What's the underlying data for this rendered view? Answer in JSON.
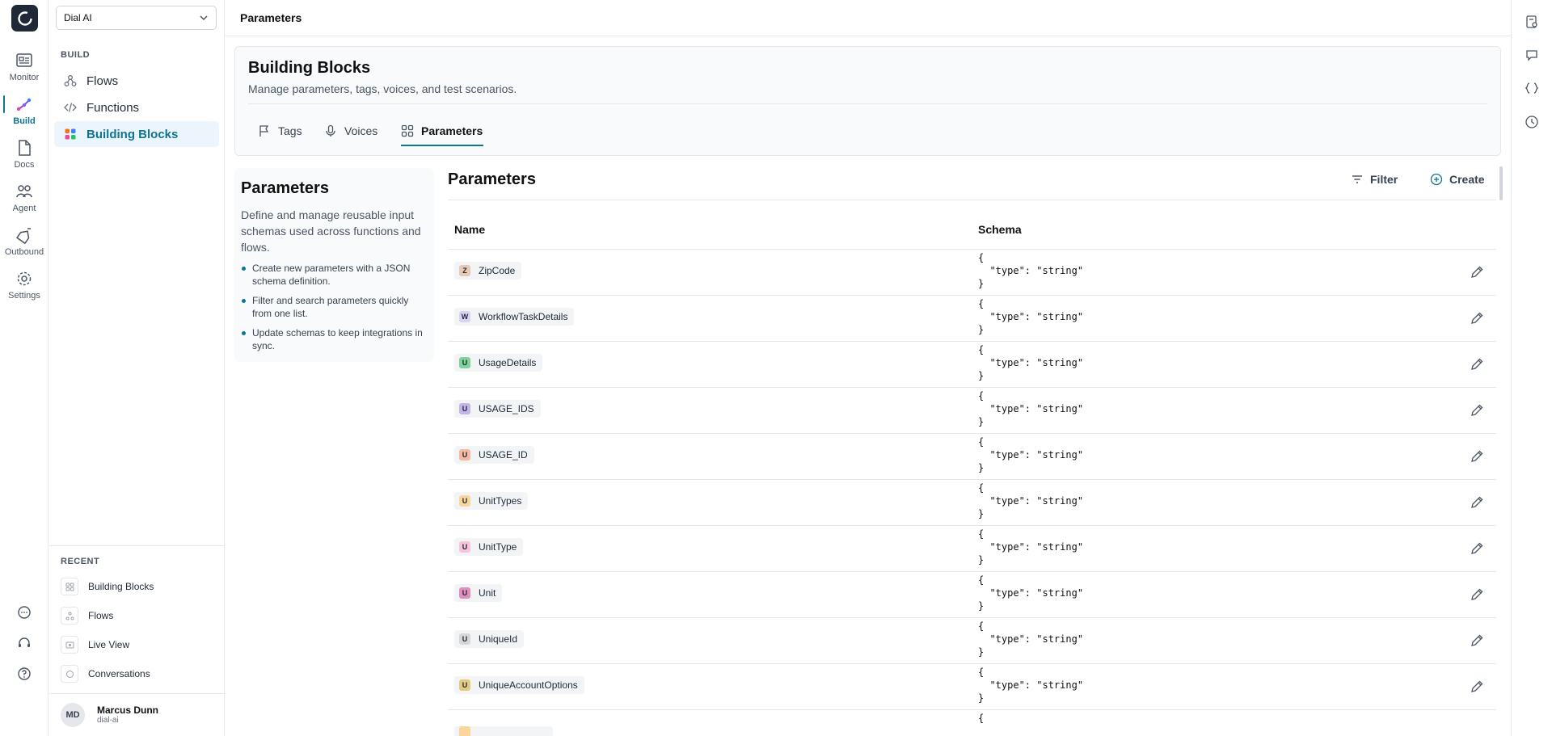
{
  "workspace": {
    "name": "Dial AI"
  },
  "rail": {
    "items": [
      {
        "label": "Monitor",
        "icon": "monitor-icon"
      },
      {
        "label": "Build",
        "icon": "build-icon",
        "active": true
      },
      {
        "label": "Docs",
        "icon": "docs-icon"
      },
      {
        "label": "Agent",
        "icon": "agent-icon"
      },
      {
        "label": "Outbound",
        "icon": "outbound-icon"
      },
      {
        "label": "Settings",
        "icon": "settings-icon"
      }
    ]
  },
  "sidebar": {
    "section_build": "BUILD",
    "items": [
      {
        "label": "Flows",
        "icon": "flows-icon"
      },
      {
        "label": "Functions",
        "icon": "code-icon"
      },
      {
        "label": "Building Blocks",
        "icon": "blocks-icon",
        "active": true
      }
    ],
    "section_recent": "RECENT",
    "recent": [
      {
        "label": "Building Blocks",
        "icon": "blocks-icon"
      },
      {
        "label": "Flows",
        "icon": "flows-icon"
      },
      {
        "label": "Live View",
        "icon": "live-view-icon"
      },
      {
        "label": "Conversations",
        "icon": "conversation-icon"
      }
    ]
  },
  "user": {
    "initials": "MD",
    "name": "Marcus Dunn",
    "handle": "dial-ai"
  },
  "header": {
    "title": "Parameters"
  },
  "building_blocks": {
    "title": "Building Blocks",
    "description": "Manage parameters, tags, voices, and test scenarios.",
    "tabs": [
      {
        "label": "Tags",
        "icon": "flag-icon"
      },
      {
        "label": "Voices",
        "icon": "microphone-icon"
      },
      {
        "label": "Parameters",
        "icon": "grid-icon",
        "active": true
      }
    ]
  },
  "info": {
    "title": "Parameters",
    "description": "Define and manage reusable input schemas used across functions and flows.",
    "bullets": [
      "Create new parameters with a JSON schema definition.",
      "Filter and search parameters quickly from one list.",
      "Update schemas to keep integrations in sync."
    ]
  },
  "table": {
    "title": "Parameters",
    "filter_label": "Filter",
    "create_label": "Create",
    "columns": [
      "Name",
      "Schema"
    ],
    "rows": [
      {
        "letter": "Z",
        "name": "ZipCode",
        "color": "#e7c9b8",
        "schema": "{\n  \"type\": \"string\"\n}"
      },
      {
        "letter": "W",
        "name": "WorkflowTaskDetails",
        "color": "#d9d2f3",
        "schema": "{\n  \"type\": \"string\"\n}"
      },
      {
        "letter": "U",
        "name": "UsageDetails",
        "color": "#7fd39a",
        "schema": "{\n  \"type\": \"string\"\n}"
      },
      {
        "letter": "U",
        "name": "USAGE_IDS",
        "color": "#c6b3ea",
        "schema": "{\n  \"type\": \"string\"\n}"
      },
      {
        "letter": "U",
        "name": "USAGE_ID",
        "color": "#f4b99e",
        "schema": "{\n  \"type\": \"string\"\n}"
      },
      {
        "letter": "U",
        "name": "UnitTypes",
        "color": "#fcd59c",
        "schema": "{\n  \"type\": \"string\"\n}"
      },
      {
        "letter": "U",
        "name": "UnitType",
        "color": "#f8c4dc",
        "schema": "{\n  \"type\": \"string\"\n}"
      },
      {
        "letter": "U",
        "name": "Unit",
        "color": "#e08fbd",
        "schema": "{\n  \"type\": \"string\"\n}"
      },
      {
        "letter": "U",
        "name": "UniqueId",
        "color": "#d7d7d7",
        "schema": "{\n  \"type\": \"string\"\n}"
      },
      {
        "letter": "U",
        "name": "UniqueAccountOptions",
        "color": "#e4c983",
        "schema": "{\n  \"type\": \"string\"\n}"
      },
      {
        "letter": "",
        "name": "",
        "color": "#fcd59c",
        "schema": "{"
      }
    ]
  },
  "colors": {
    "accent": "#0e7490"
  }
}
